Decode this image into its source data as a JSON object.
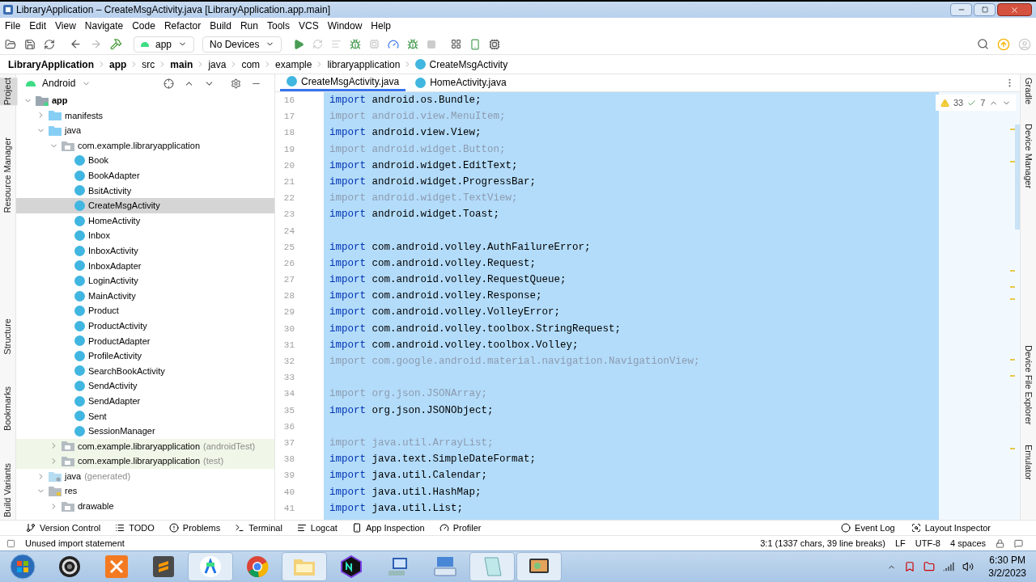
{
  "window": {
    "title": "LibraryApplication – CreateMsgActivity.java [LibraryApplication.app.main]"
  },
  "menu": [
    "File",
    "Edit",
    "View",
    "Navigate",
    "Code",
    "Refactor",
    "Build",
    "Run",
    "Tools",
    "VCS",
    "Window",
    "Help"
  ],
  "toolbar": {
    "config": "app",
    "device": "No Devices"
  },
  "breadcrumb": [
    {
      "label": "LibraryApplication",
      "bold": true
    },
    {
      "label": "app",
      "bold": true
    },
    {
      "label": "src",
      "bold": false
    },
    {
      "label": "main",
      "bold": true
    },
    {
      "label": "java",
      "bold": false
    },
    {
      "label": "com",
      "bold": false
    },
    {
      "label": "example",
      "bold": false
    },
    {
      "label": "libraryapplication",
      "bold": false
    },
    {
      "label": "CreateMsgActivity",
      "bold": false,
      "kind": "class"
    }
  ],
  "left_strip": [
    {
      "label": "Project",
      "selected": true
    },
    {
      "label": "Resource Manager",
      "selected": false
    },
    {
      "label": "Structure",
      "selected": false
    },
    {
      "label": "Bookmarks",
      "selected": false
    },
    {
      "label": "Build Variants",
      "selected": false
    }
  ],
  "project": {
    "view": "Android",
    "tree": [
      {
        "label": "app",
        "kind": "module",
        "expanded": true,
        "selected": false,
        "children": [
          {
            "label": "manifests",
            "kind": "folder",
            "expanded": false,
            "selected": false
          },
          {
            "label": "java",
            "kind": "folder",
            "expanded": true,
            "selected": false,
            "children": [
              {
                "label": "com.example.libraryapplication",
                "kind": "package",
                "expanded": true,
                "selected": false,
                "children": [
                  {
                    "label": "Book",
                    "kind": "class",
                    "selected": false
                  },
                  {
                    "label": "BookAdapter",
                    "kind": "class",
                    "selected": false
                  },
                  {
                    "label": "BsitActivity",
                    "kind": "class",
                    "selected": false
                  },
                  {
                    "label": "CreateMsgActivity",
                    "kind": "class",
                    "selected": true
                  },
                  {
                    "label": "HomeActivity",
                    "kind": "class",
                    "selected": false
                  },
                  {
                    "label": "Inbox",
                    "kind": "class",
                    "selected": false
                  },
                  {
                    "label": "InboxActivity",
                    "kind": "class",
                    "selected": false
                  },
                  {
                    "label": "InboxAdapter",
                    "kind": "class",
                    "selected": false
                  },
                  {
                    "label": "LoginActivity",
                    "kind": "class",
                    "selected": false
                  },
                  {
                    "label": "MainActivity",
                    "kind": "class",
                    "selected": false
                  },
                  {
                    "label": "Product",
                    "kind": "class",
                    "selected": false
                  },
                  {
                    "label": "ProductActivity",
                    "kind": "class",
                    "selected": false
                  },
                  {
                    "label": "ProductAdapter",
                    "kind": "class",
                    "selected": false
                  },
                  {
                    "label": "ProfileActivity",
                    "kind": "class",
                    "selected": false
                  },
                  {
                    "label": "SearchBookActivity",
                    "kind": "class",
                    "selected": false
                  },
                  {
                    "label": "SendActivity",
                    "kind": "class",
                    "selected": false
                  },
                  {
                    "label": "SendAdapter",
                    "kind": "class",
                    "selected": false
                  },
                  {
                    "label": "Sent",
                    "kind": "class",
                    "selected": false
                  },
                  {
                    "label": "SessionManager",
                    "kind": "class",
                    "selected": false
                  }
                ]
              },
              {
                "label": "com.example.libraryapplication",
                "suffix": "(androidTest)",
                "kind": "test-package",
                "expanded": false,
                "selected": false
              },
              {
                "label": "com.example.libraryapplication",
                "suffix": "(test)",
                "kind": "test-package",
                "expanded": false,
                "selected": false
              }
            ]
          },
          {
            "label": "java",
            "suffix": "(generated)",
            "kind": "generated-folder",
            "expanded": false,
            "selected": false
          },
          {
            "label": "res",
            "kind": "res-folder",
            "expanded": true,
            "selected": false,
            "children": [
              {
                "label": "drawable",
                "kind": "package",
                "expanded": false,
                "selected": false
              }
            ]
          }
        ]
      }
    ]
  },
  "editor_tabs": [
    {
      "label": "CreateMsgActivity.java",
      "selected": true
    },
    {
      "label": "HomeActivity.java",
      "selected": false
    }
  ],
  "inspections": {
    "warnings": "33",
    "weak_warnings": "7"
  },
  "code": [
    {
      "number": "16",
      "keyword": "import",
      "rest": "android.os.Bundle;",
      "unused": false
    },
    {
      "number": "17",
      "keyword": "import",
      "rest": "android.view.MenuItem;",
      "unused": true
    },
    {
      "number": "18",
      "keyword": "import",
      "rest": "android.view.View;",
      "unused": false
    },
    {
      "number": "19",
      "keyword": "import",
      "rest": "android.widget.Button;",
      "unused": true
    },
    {
      "number": "20",
      "keyword": "import",
      "rest": "android.widget.EditText;",
      "unused": false
    },
    {
      "number": "21",
      "keyword": "import",
      "rest": "android.widget.ProgressBar;",
      "unused": false
    },
    {
      "number": "22",
      "keyword": "import",
      "rest": "android.widget.TextView;",
      "unused": true
    },
    {
      "number": "23",
      "keyword": "import",
      "rest": "android.widget.Toast;",
      "unused": false
    },
    {
      "number": "24"
    },
    {
      "number": "25",
      "keyword": "import",
      "rest": "com.android.volley.AuthFailureError;",
      "unused": false
    },
    {
      "number": "26",
      "keyword": "import",
      "rest": "com.android.volley.Request;",
      "unused": false
    },
    {
      "number": "27",
      "keyword": "import",
      "rest": "com.android.volley.RequestQueue;",
      "unused": false
    },
    {
      "number": "28",
      "keyword": "import",
      "rest": "com.android.volley.Response;",
      "unused": false
    },
    {
      "number": "29",
      "keyword": "import",
      "rest": "com.android.volley.VolleyError;",
      "unused": false
    },
    {
      "number": "30",
      "keyword": "import",
      "rest": "com.android.volley.toolbox.StringRequest;",
      "unused": false
    },
    {
      "number": "31",
      "keyword": "import",
      "rest": "com.android.volley.toolbox.Volley;",
      "unused": false
    },
    {
      "number": "32",
      "keyword": "import",
      "rest": "com.google.android.material.navigation.NavigationView;",
      "unused": true
    },
    {
      "number": "33"
    },
    {
      "number": "34",
      "keyword": "import",
      "rest": "org.json.JSONArray;",
      "unused": true
    },
    {
      "number": "35",
      "keyword": "import",
      "rest": "org.json.JSONObject;",
      "unused": false
    },
    {
      "number": "36"
    },
    {
      "number": "37",
      "keyword": "import",
      "rest": "java.util.ArrayList;",
      "unused": true
    },
    {
      "number": "38",
      "keyword": "import",
      "rest": "java.text.SimpleDateFormat;",
      "unused": false
    },
    {
      "number": "39",
      "keyword": "import",
      "rest": "java.util.Calendar;",
      "unused": false
    },
    {
      "number": "40",
      "keyword": "import",
      "rest": "java.util.HashMap;",
      "unused": false
    },
    {
      "number": "41",
      "keyword": "import",
      "rest": "java.util.List;",
      "unused": false
    }
  ],
  "right_strip": [
    "Gradle",
    "Device Manager",
    "Device File Explorer",
    "Emulator"
  ],
  "tool_windows_left": [
    {
      "label": "Version Control",
      "kind": "vcs"
    },
    {
      "label": "TODO",
      "kind": "todo"
    },
    {
      "label": "Problems",
      "kind": "problems"
    },
    {
      "label": "Terminal",
      "kind": "terminal"
    },
    {
      "label": "Logcat",
      "kind": "logcat"
    },
    {
      "label": "App Inspection",
      "kind": "inspection"
    },
    {
      "label": "Profiler",
      "kind": "profiler"
    }
  ],
  "tool_windows_right": [
    {
      "label": "Event Log",
      "kind": "eventlog"
    },
    {
      "label": "Layout Inspector",
      "kind": "layout"
    }
  ],
  "status_bar": {
    "message": "Unused import statement",
    "position": "3:1 (1337 chars, 39 line breaks)",
    "line_separator": "LF",
    "encoding": "UTF-8",
    "indent": "4 spaces"
  },
  "taskbar": {
    "apps": [
      {
        "kind": "disc",
        "selected": false
      },
      {
        "kind": "xampp",
        "selected": false
      },
      {
        "kind": "sublime",
        "selected": false
      },
      {
        "kind": "android-studio",
        "selected": true
      },
      {
        "kind": "chrome",
        "selected": false
      },
      {
        "kind": "explorer",
        "selected": true
      },
      {
        "kind": "nox",
        "selected": false
      },
      {
        "kind": "computer",
        "selected": false
      },
      {
        "kind": "keyboard",
        "selected": false
      },
      {
        "kind": "notepad",
        "selected": true
      },
      {
        "kind": "monitor",
        "selected": true
      }
    ],
    "time": "6:30 PM",
    "date": "3/2/2023"
  }
}
